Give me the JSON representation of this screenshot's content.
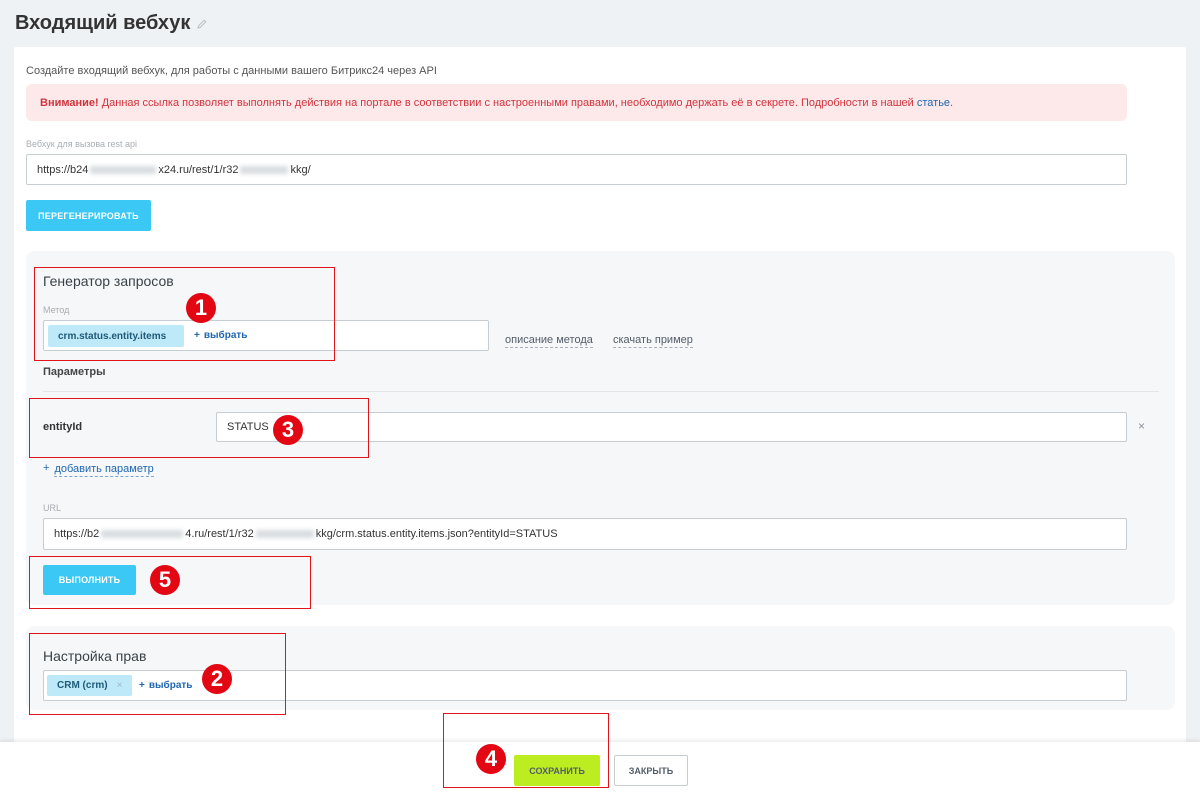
{
  "page": {
    "title": "Входящий вебхук",
    "hint": "Создайте входящий вебхук, для работы с данными вашего Битрикс24 через API"
  },
  "alert": {
    "strong": "Внимание!",
    "text": " Данная ссылка позволяет выполнять действия на портале в соответствии с настроенными правами, необходимо держать её в секрете. Подробности в нашей ",
    "link": "статье",
    "tail": "."
  },
  "webhook": {
    "label": "Вебхук для вызова rest api",
    "url_start": "https://b24",
    "url_mid": "x24.ru/rest/1/r32",
    "url_end": "kkg/",
    "regenerate_label": "ПЕРЕГЕНЕРИРОВАТЬ"
  },
  "generator": {
    "title": "Генератор запросов",
    "method_label": "Метод",
    "method_value": "crm.status.entity.items",
    "select_label": "выбрать",
    "describe_link": "описание метода",
    "download_link": "скачать пример",
    "params_title": "Параметры",
    "param_name": "entityId",
    "param_value": "STATUS",
    "add_param_label": "добавить параметр",
    "url_label": "URL",
    "url_start": "https://b2",
    "url_mid": "4.ru/rest/1/r32",
    "url_end": "kkg/crm.status.entity.items.json?entityId=STATUS",
    "execute_label": "ВЫПОЛНИТЬ"
  },
  "rights": {
    "title": "Настройка прав",
    "scope_tag": "CRM (crm)",
    "select_label": "выбрать"
  },
  "footer": {
    "save_label": "СОХРАНИТЬ",
    "close_label": "ЗАКРЫТЬ"
  },
  "markers": [
    "1",
    "2",
    "3",
    "4",
    "5"
  ],
  "colors": {
    "accent_blue": "#3bc8f5",
    "save_green": "#bbed21",
    "marker_red": "#e30613",
    "alert_bg": "#fde9e9"
  }
}
